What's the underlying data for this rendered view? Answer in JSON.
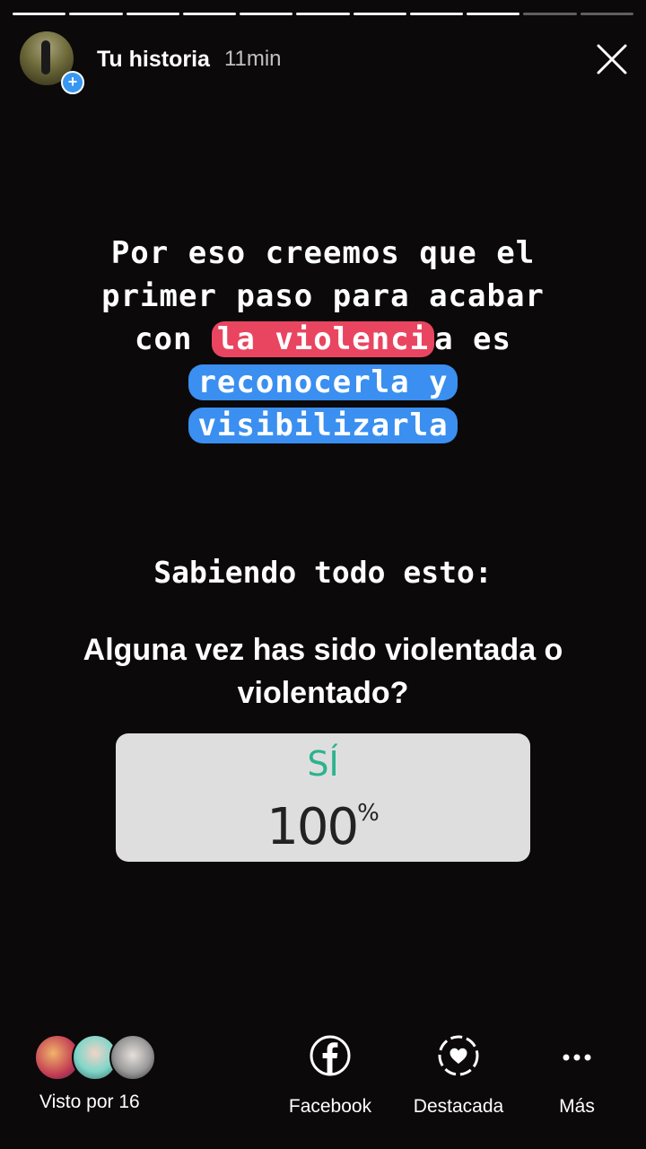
{
  "story": {
    "segments_total": 11,
    "segments_viewed": 9
  },
  "header": {
    "title": "Tu historia",
    "time": "11min",
    "add_symbol": "+"
  },
  "content": {
    "line1": "Por eso creemos que el",
    "line2": "primer paso para acabar",
    "line3_pre": "con ",
    "line3_highlight": "la violenci",
    "line3_post": "a es",
    "line4": "reconocerla y",
    "line5": "visibilizarla",
    "subtitle": "Sabiendo todo esto:",
    "question": "Alguna vez has sido violentada o violentado?"
  },
  "poll": {
    "option": "SÍ",
    "percent": "100",
    "percent_unit": "%"
  },
  "footer": {
    "seen_label": "Visto por 16",
    "facebook_label": "Facebook",
    "highlight_label": "Destacada",
    "more_label": "Más"
  },
  "colors": {
    "highlight_red": "#e94560",
    "highlight_blue": "#3a8ff0",
    "poll_option": "#2bb38e",
    "badge_blue": "#3897f0"
  },
  "icons": [
    "close-icon",
    "facebook-icon",
    "highlight-heart-icon",
    "more-icon"
  ]
}
